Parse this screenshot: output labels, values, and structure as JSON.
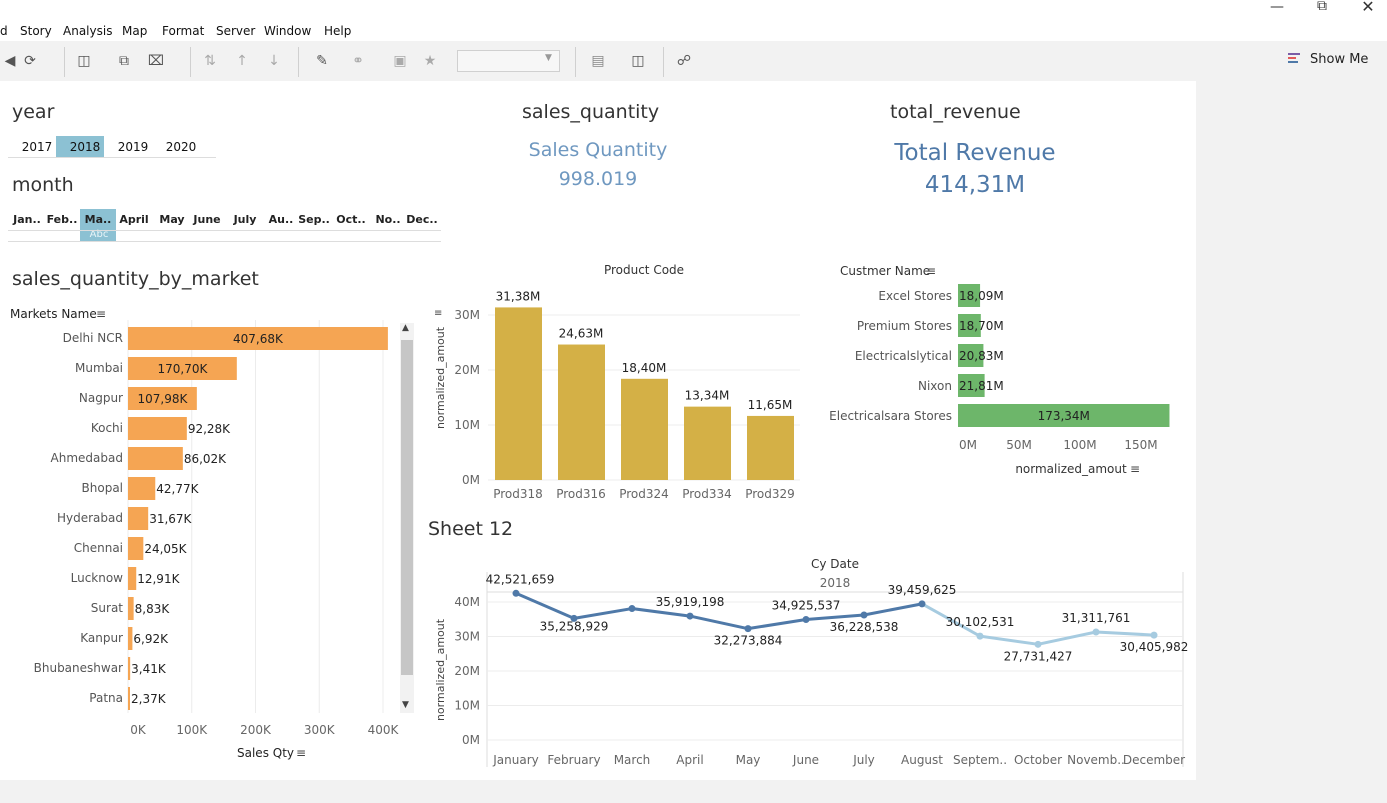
{
  "menu": {
    "items": [
      {
        "pre": "d",
        "label": ""
      },
      {
        "pre": "",
        "label": "Story"
      },
      {
        "pre": "",
        "label": "Analysis"
      },
      {
        "pre": "",
        "label": "Map"
      },
      {
        "pre": "",
        "label": "Format"
      },
      {
        "pre": "",
        "label": "Server"
      },
      {
        "pre": "",
        "label": "Window"
      },
      {
        "pre": "",
        "label": "Help"
      }
    ]
  },
  "toolbar": {
    "show_me_label": "Show Me"
  },
  "filters": {
    "year_title": "year",
    "years": [
      "2017",
      "2018",
      "2019",
      "2020"
    ],
    "selected_year": "2018",
    "month_title": "month",
    "months": [
      "Jan..",
      "Feb..",
      "Ma..",
      "April",
      "May",
      "June",
      "July",
      "Au..",
      "Sep..",
      "Oct..",
      "No..",
      "Dec.."
    ],
    "selected_month": "Ma..",
    "selected_month_sub": "Abc"
  },
  "kpi": {
    "sales_quantity_title": "sales_quantity",
    "sales_quantity_label": "Sales Quantity",
    "sales_quantity_value": "998.019",
    "total_revenue_title": "total_revenue",
    "total_revenue_label": "Total Revenue",
    "total_revenue_value": "414,31M",
    "color_sales": "#6f98c0",
    "color_revenue": "#4f79a8"
  },
  "markets": {
    "title": "sales_quantity_by_market",
    "header": "Markets Name",
    "x_axis_label": "Sales Qty",
    "color": "#f5a553"
  },
  "product": {
    "header": "Product Code",
    "y_axis_label": "normalized_amout",
    "color": "#d4b046"
  },
  "customer": {
    "header": "Custmer Name",
    "x_axis_label": "normalized_amout",
    "color": "#6db66a"
  },
  "sheet12": {
    "title": "Sheet 12",
    "header": "Cy Date",
    "sub_header": "2018",
    "y_axis_label": "normalized_amout",
    "color_dark": "#4f79a8",
    "color_light": "#a6cbe0"
  },
  "chart_data": [
    {
      "type": "bar",
      "orientation": "horizontal",
      "categories": [
        "Delhi NCR",
        "Mumbai",
        "Nagpur",
        "Kochi",
        "Ahmedabad",
        "Bhopal",
        "Hyderabad",
        "Chennai",
        "Lucknow",
        "Surat",
        "Kanpur",
        "Bhubaneshwar",
        "Patna"
      ],
      "values": [
        407680,
        170700,
        107980,
        92280,
        86020,
        42770,
        31670,
        24050,
        12910,
        8830,
        6920,
        3410,
        2370
      ],
      "labels": [
        "407,68K",
        "170,70K",
        "107,98K",
        "92,28K",
        "86,02K",
        "42,77K",
        "31,67K",
        "24,05K",
        "12,91K",
        "8,83K",
        "6,92K",
        "3,41K",
        "2,37K"
      ],
      "xlabel": "Sales Qty",
      "ylabel": "Markets Name",
      "xlim": [
        0,
        400000
      ],
      "ticks": [
        "0K",
        "100K",
        "200K",
        "300K",
        "400K"
      ],
      "grid": true
    },
    {
      "type": "bar",
      "orientation": "vertical",
      "categories": [
        "Prod318",
        "Prod316",
        "Prod324",
        "Prod334",
        "Prod329"
      ],
      "values": [
        31.38,
        24.63,
        18.4,
        13.34,
        11.65
      ],
      "labels": [
        "31,38M",
        "24,63M",
        "18,40M",
        "13,34M",
        "11,65M"
      ],
      "title": "Product Code",
      "ylabel": "normalized_amout",
      "ylim": [
        0,
        30
      ],
      "ticks": [
        "0M",
        "10M",
        "20M",
        "30M"
      ],
      "grid": true
    },
    {
      "type": "bar",
      "orientation": "horizontal",
      "categories": [
        "Excel Stores",
        "Premium Stores",
        "Electricalslytical",
        "Nixon",
        "Electricalsara Stores"
      ],
      "values": [
        18.09,
        18.7,
        20.83,
        21.81,
        173.34
      ],
      "labels": [
        "18,09M",
        "18,70M",
        "20,83M",
        "21,81M",
        "173,34M"
      ],
      "title": "Custmer Name",
      "xlabel": "normalized_amout",
      "xlim": [
        0,
        150
      ],
      "ticks": [
        "0M",
        "50M",
        "100M",
        "150M"
      ]
    },
    {
      "type": "line",
      "categories": [
        "January",
        "February",
        "March",
        "April",
        "May",
        "June",
        "July",
        "August",
        "Septem..",
        "October",
        "Novemb..",
        "December"
      ],
      "values": [
        42521659,
        35258929,
        38100000,
        35919198,
        32273884,
        34925537,
        36228538,
        39459625,
        30102531,
        27731427,
        31311761,
        30405982
      ],
      "labels": [
        "42,521,659",
        "35,258,929",
        "",
        "35,919,198",
        "32,273,884",
        "34,925,537",
        "36,228,538",
        "39,459,625",
        "30,102,531",
        "27,731,427",
        "31,311,761",
        "30,405,982"
      ],
      "title": "Cy Date",
      "subtitle": "2018",
      "ylabel": "normalized_amout",
      "ylim": [
        0,
        40000000
      ],
      "ticks": [
        "0M",
        "10M",
        "20M",
        "30M",
        "40M"
      ],
      "grid": true
    }
  ]
}
